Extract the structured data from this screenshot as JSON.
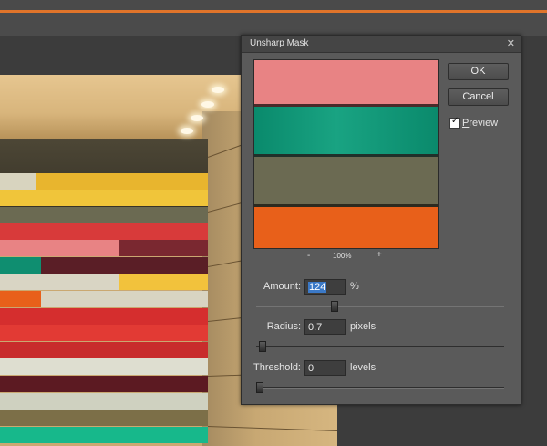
{
  "dialog": {
    "title": "Unsharp Mask",
    "close_icon": "close-icon",
    "ok_label": "OK",
    "cancel_label": "Cancel",
    "preview_label": "Preview",
    "preview_checked": true,
    "zoom_level": "100%",
    "zoom_out_label": "-",
    "zoom_in_label": "+"
  },
  "fields": {
    "amount": {
      "label": "Amount:",
      "value": "124",
      "unit": "%",
      "slider_fraction": 0.31
    },
    "radius": {
      "label": "Radius:",
      "value": "0.7",
      "unit": "pixels",
      "slider_fraction": 0.01
    },
    "threshold": {
      "label": "Threshold:",
      "value": "0",
      "unit": "levels",
      "slider_fraction": 0.0
    }
  },
  "colors": {
    "accent": "#e0742a",
    "preview_pink": "#e88384",
    "preview_teal": "#0f8e70",
    "preview_olive": "#6b6a52",
    "preview_orange": "#e8601a"
  }
}
